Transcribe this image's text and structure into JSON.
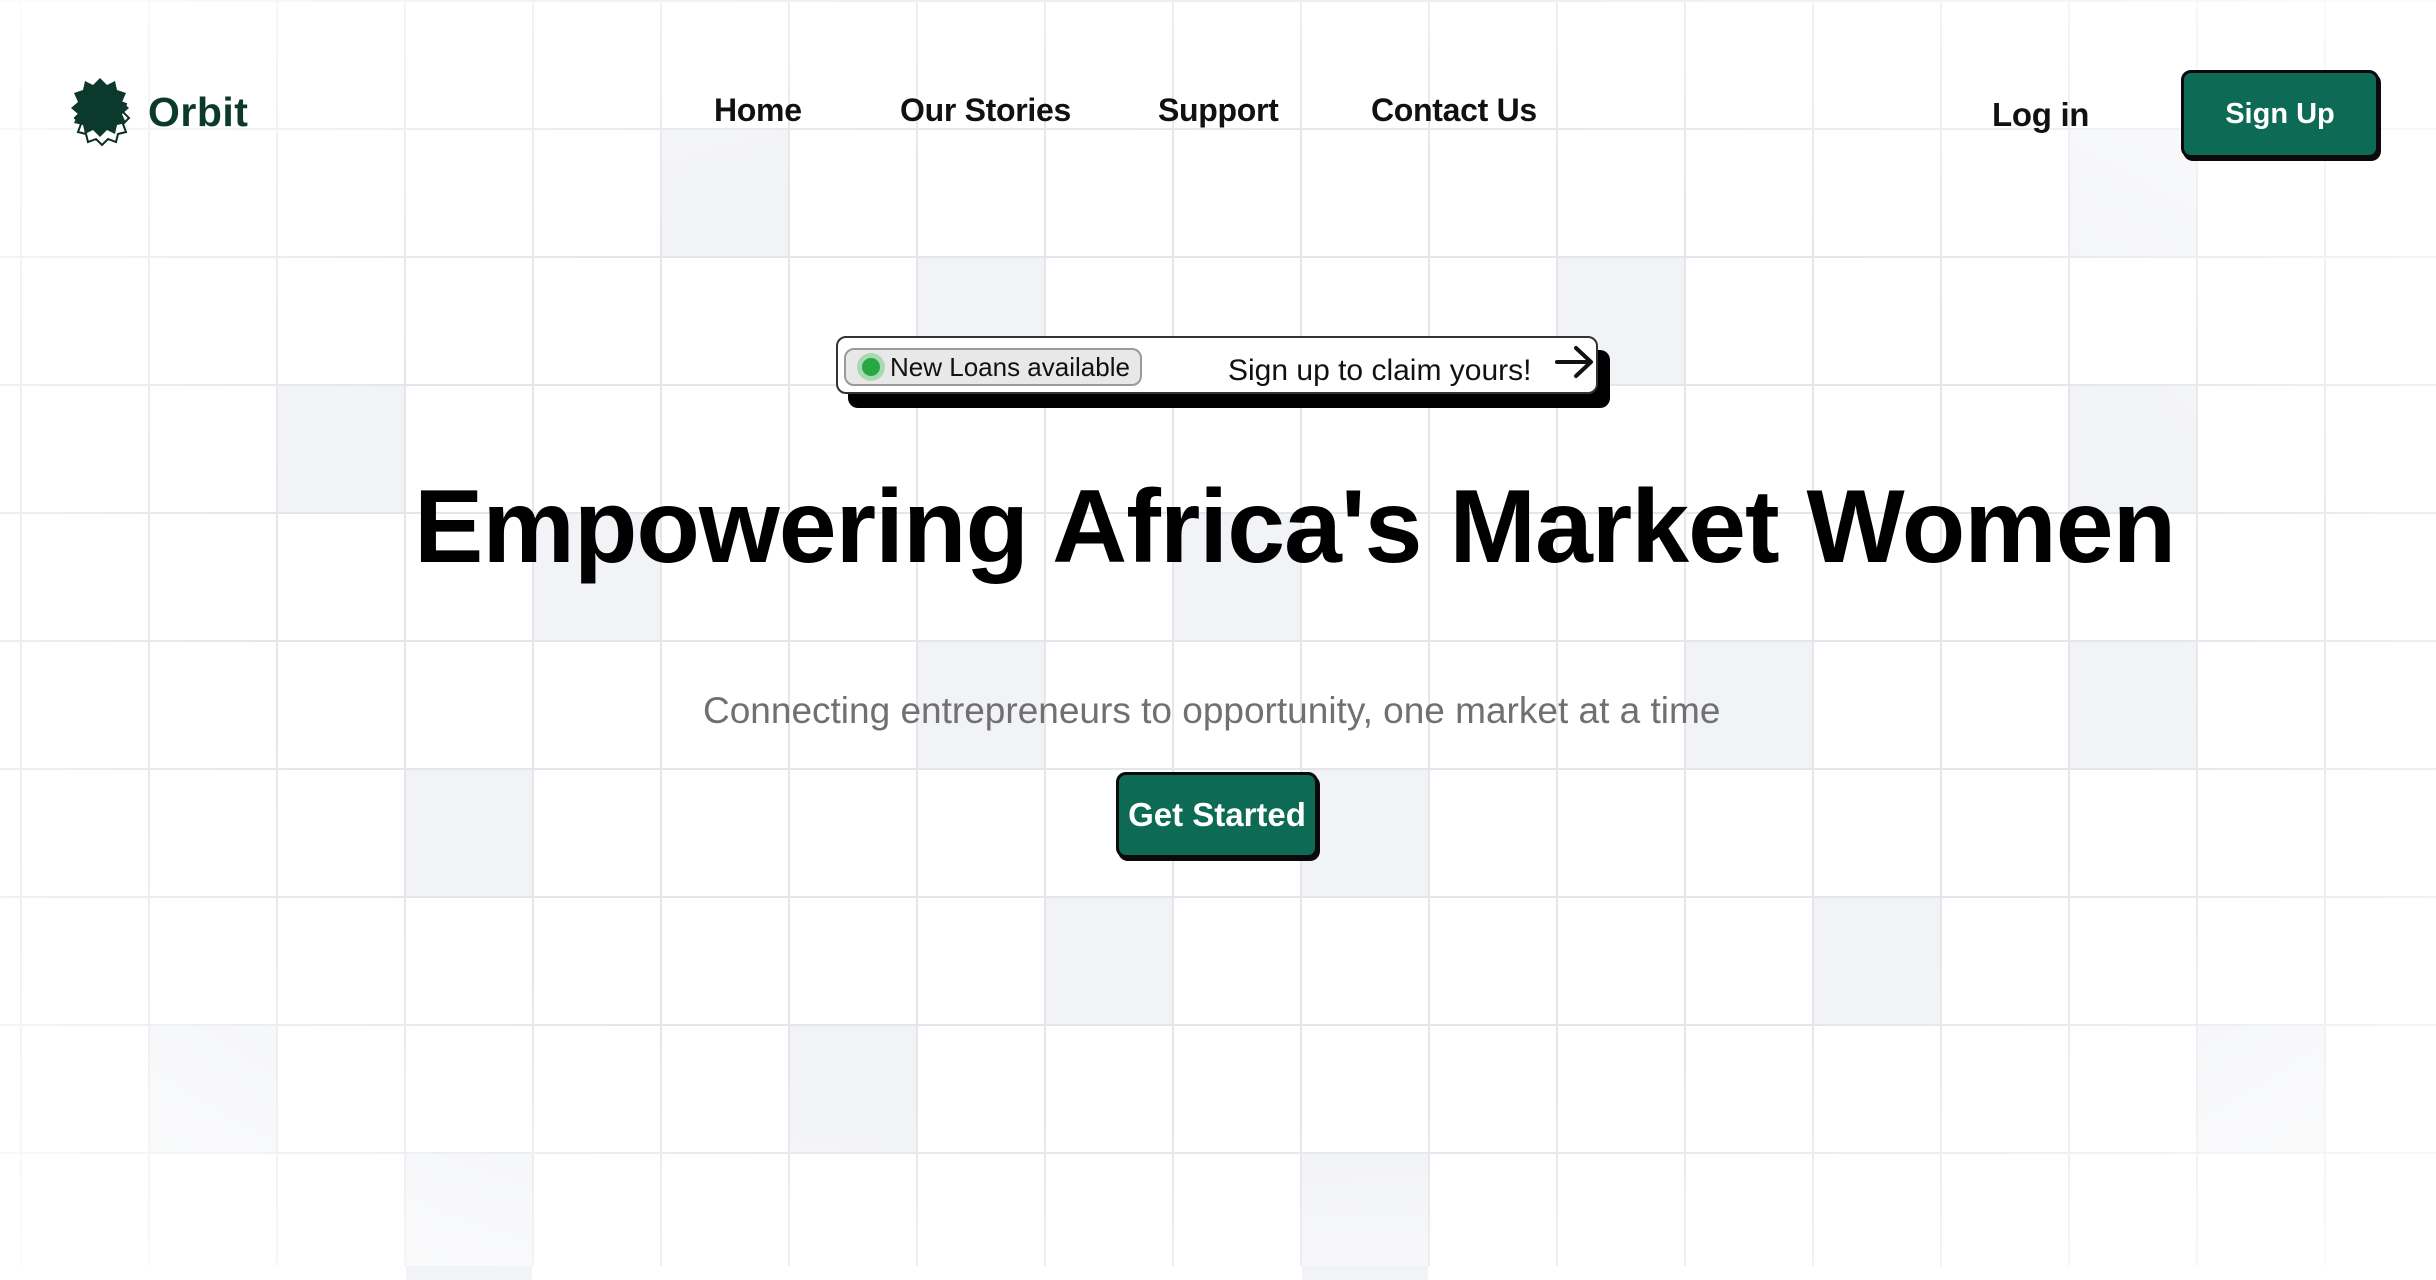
{
  "brand": {
    "name": "Orbit",
    "logo_icon": "gear-badge-icon",
    "color": "#0b3a2c"
  },
  "nav": {
    "items": [
      {
        "label": "Home"
      },
      {
        "label": "Our Stories"
      },
      {
        "label": "Support"
      },
      {
        "label": "Contact Us"
      }
    ],
    "login_label": "Log in",
    "signup_label": "Sign Up"
  },
  "banner": {
    "tag_label": "New Loans available",
    "cta_text": "Sign up to claim yours!",
    "status_color": "#27a845",
    "arrow_icon": "arrow-right-icon"
  },
  "hero": {
    "title": "Empowering Africa's Market Women",
    "subtitle": "Connecting entrepreneurs to opportunity, one market at a time",
    "cta_label": "Get Started"
  },
  "theme": {
    "accent": "#0d6b55",
    "grid_line": "#e4e6ea"
  }
}
